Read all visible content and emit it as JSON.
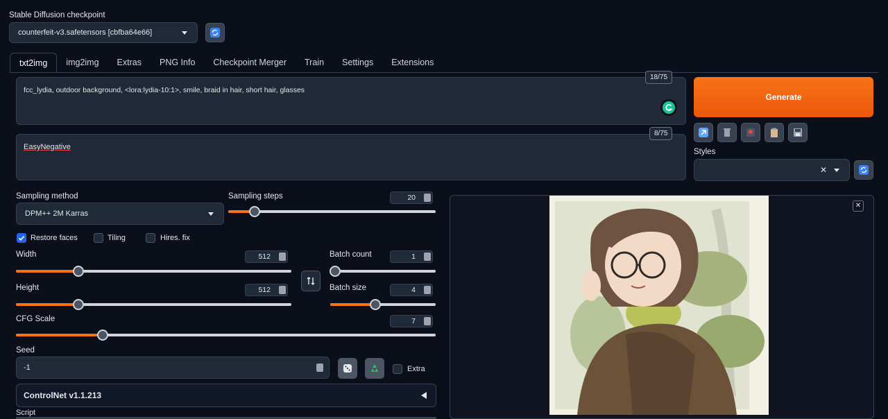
{
  "checkpoint": {
    "label": "Stable Diffusion checkpoint",
    "value": "counterfeit-v3.safetensors [cbfba64e66]"
  },
  "tabs": [
    {
      "label": "txt2img",
      "active": true
    },
    {
      "label": "img2img"
    },
    {
      "label": "Extras"
    },
    {
      "label": "PNG Info"
    },
    {
      "label": "Checkpoint Merger"
    },
    {
      "label": "Train"
    },
    {
      "label": "Settings"
    },
    {
      "label": "Extensions"
    }
  ],
  "prompt": {
    "text": "fcc_lydia, outdoor background, <lora:lydia-10:1>, smile, braid in hair, short hair, glasses",
    "counter": "18/75"
  },
  "negative_prompt": {
    "text": "EasyNegative",
    "counter": "8/75"
  },
  "generate_label": "Generate",
  "styles": {
    "label": "Styles",
    "value": ""
  },
  "sampling_method": {
    "label": "Sampling method",
    "value": "DPM++ 2M Karras"
  },
  "sampling_steps": {
    "label": "Sampling steps",
    "value": "20",
    "min": 1,
    "max": 150
  },
  "checkboxes": {
    "restore_faces": {
      "label": "Restore faces",
      "checked": true
    },
    "tiling": {
      "label": "Tiling",
      "checked": false
    },
    "hires_fix": {
      "label": "Hires. fix",
      "checked": false
    }
  },
  "width": {
    "label": "Width",
    "value": "512",
    "min": 64,
    "max": 2048
  },
  "height": {
    "label": "Height",
    "value": "512",
    "min": 64,
    "max": 2048
  },
  "batch_count": {
    "label": "Batch count",
    "value": "1",
    "min": 1,
    "max": 100
  },
  "batch_size": {
    "label": "Batch size",
    "value": "4",
    "min": 1,
    "max": 8
  },
  "cfg_scale": {
    "label": "CFG Scale",
    "value": "7",
    "min": 1,
    "max": 30
  },
  "seed": {
    "label": "Seed",
    "value": "-1",
    "extra_label": "Extra"
  },
  "controlnet_label": "ControlNet v1.1.213",
  "script_label": "Script",
  "colors": {
    "accent": "#f97316",
    "background": "#0b0f19",
    "panel": "#1f2937",
    "checkbox": "#2563eb"
  }
}
